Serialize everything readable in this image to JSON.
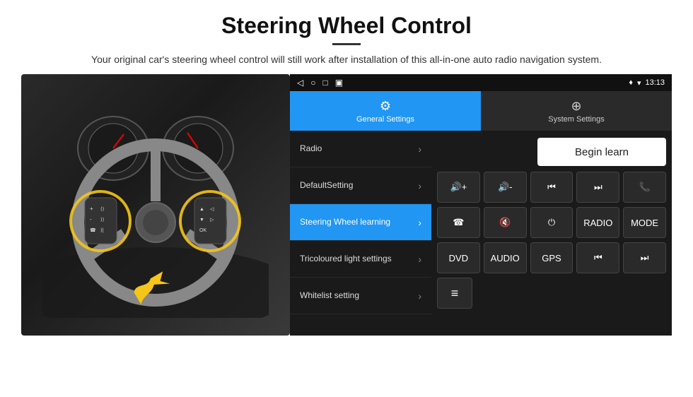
{
  "header": {
    "title": "Steering Wheel Control",
    "subtitle": "Your original car's steering wheel control will still work after installation of this all-in-one auto radio navigation system."
  },
  "status_bar": {
    "nav_icons": [
      "◁",
      "○",
      "□",
      "▣"
    ],
    "time": "13:13",
    "signal_icons": "♦ ▾"
  },
  "tabs": {
    "general": {
      "label": "General Settings",
      "icon": "⚙"
    },
    "system": {
      "label": "System Settings",
      "icon": "⊕"
    }
  },
  "menu": {
    "items": [
      {
        "label": "Radio",
        "active": false
      },
      {
        "label": "DefaultSetting",
        "active": false
      },
      {
        "label": "Steering Wheel learning",
        "active": true
      },
      {
        "label": "Tricoloured light settings",
        "active": false
      },
      {
        "label": "Whitelist setting",
        "active": false
      }
    ]
  },
  "controls": {
    "begin_learn": "Begin learn",
    "row1": [
      "🔊+",
      "🔊-",
      "⏮",
      "⏭",
      "📞"
    ],
    "row2": [
      "☎",
      "🔊×",
      "⏻",
      "RADIO",
      "MODE"
    ],
    "row3": [
      "DVD",
      "AUDIO",
      "GPS",
      "⏮",
      "⏭"
    ],
    "icon_row": [
      "≡"
    ]
  }
}
